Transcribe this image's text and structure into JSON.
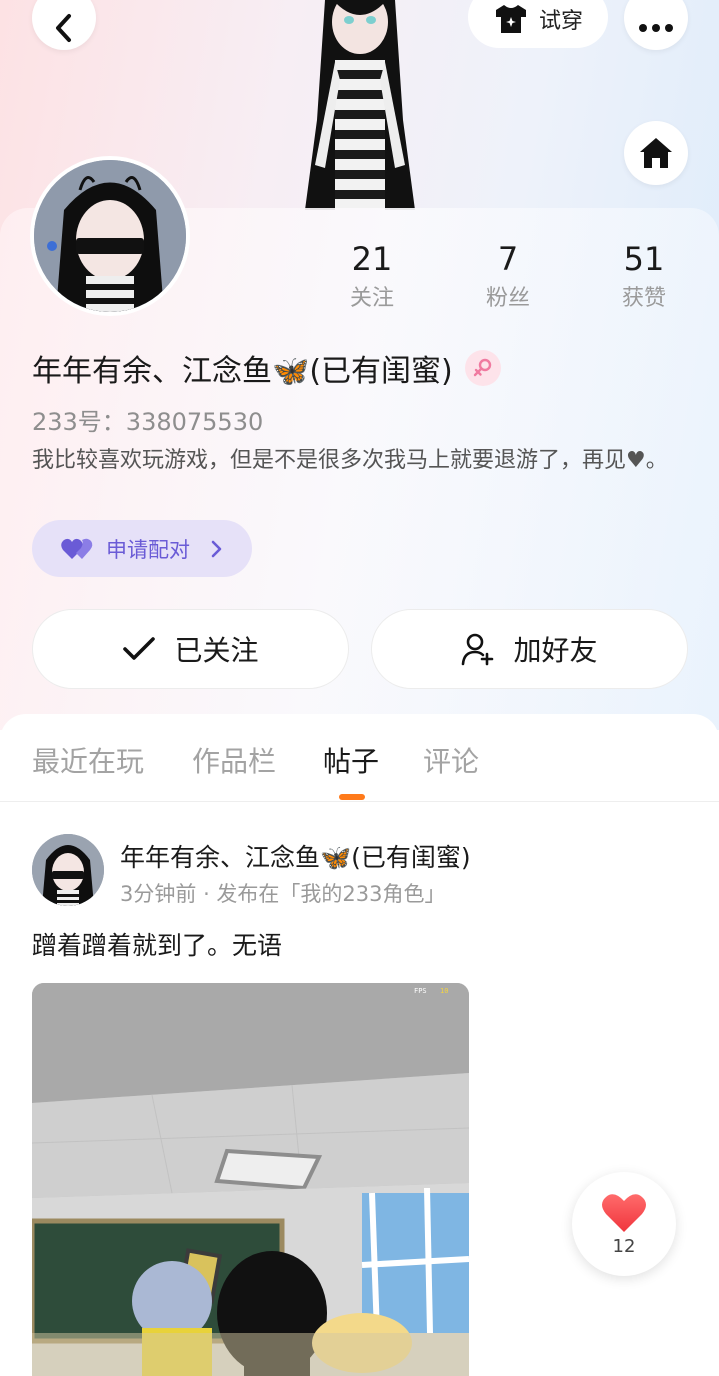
{
  "header": {
    "tryon_label": "试穿"
  },
  "profile": {
    "stats": [
      {
        "value": "21",
        "label": "关注"
      },
      {
        "value": "7",
        "label": "粉丝"
      },
      {
        "value": "51",
        "label": "获赞"
      }
    ],
    "nickname": "年年有余、江念鱼🦋(已有闺蜜)",
    "id_line": "233号：338075530",
    "bio": "我比较喜欢玩游戏，但是不是很多次我马上就要退游了，再见♥。",
    "pair_label": "申请配对",
    "follow_label": "已关注",
    "add_friend_label": "加好友",
    "gender": "female"
  },
  "tabs": [
    {
      "label": "最近在玩"
    },
    {
      "label": "作品栏"
    },
    {
      "label": "帖子"
    },
    {
      "label": "评论"
    }
  ],
  "active_tab": "帖子",
  "post": {
    "author": "年年有余、江念鱼🦋(已有闺蜜)",
    "time": "3分钟前",
    "location": "发布在「我的233角色」",
    "text": "蹭着蹭着就到了。无语",
    "fps_label": "FPS",
    "fps_value": "10",
    "likes": "12"
  },
  "colors": {
    "accent_orange": "#ff7a1a",
    "pair_purple": "#6a5bd6",
    "like_red": "#ff4d5a"
  }
}
